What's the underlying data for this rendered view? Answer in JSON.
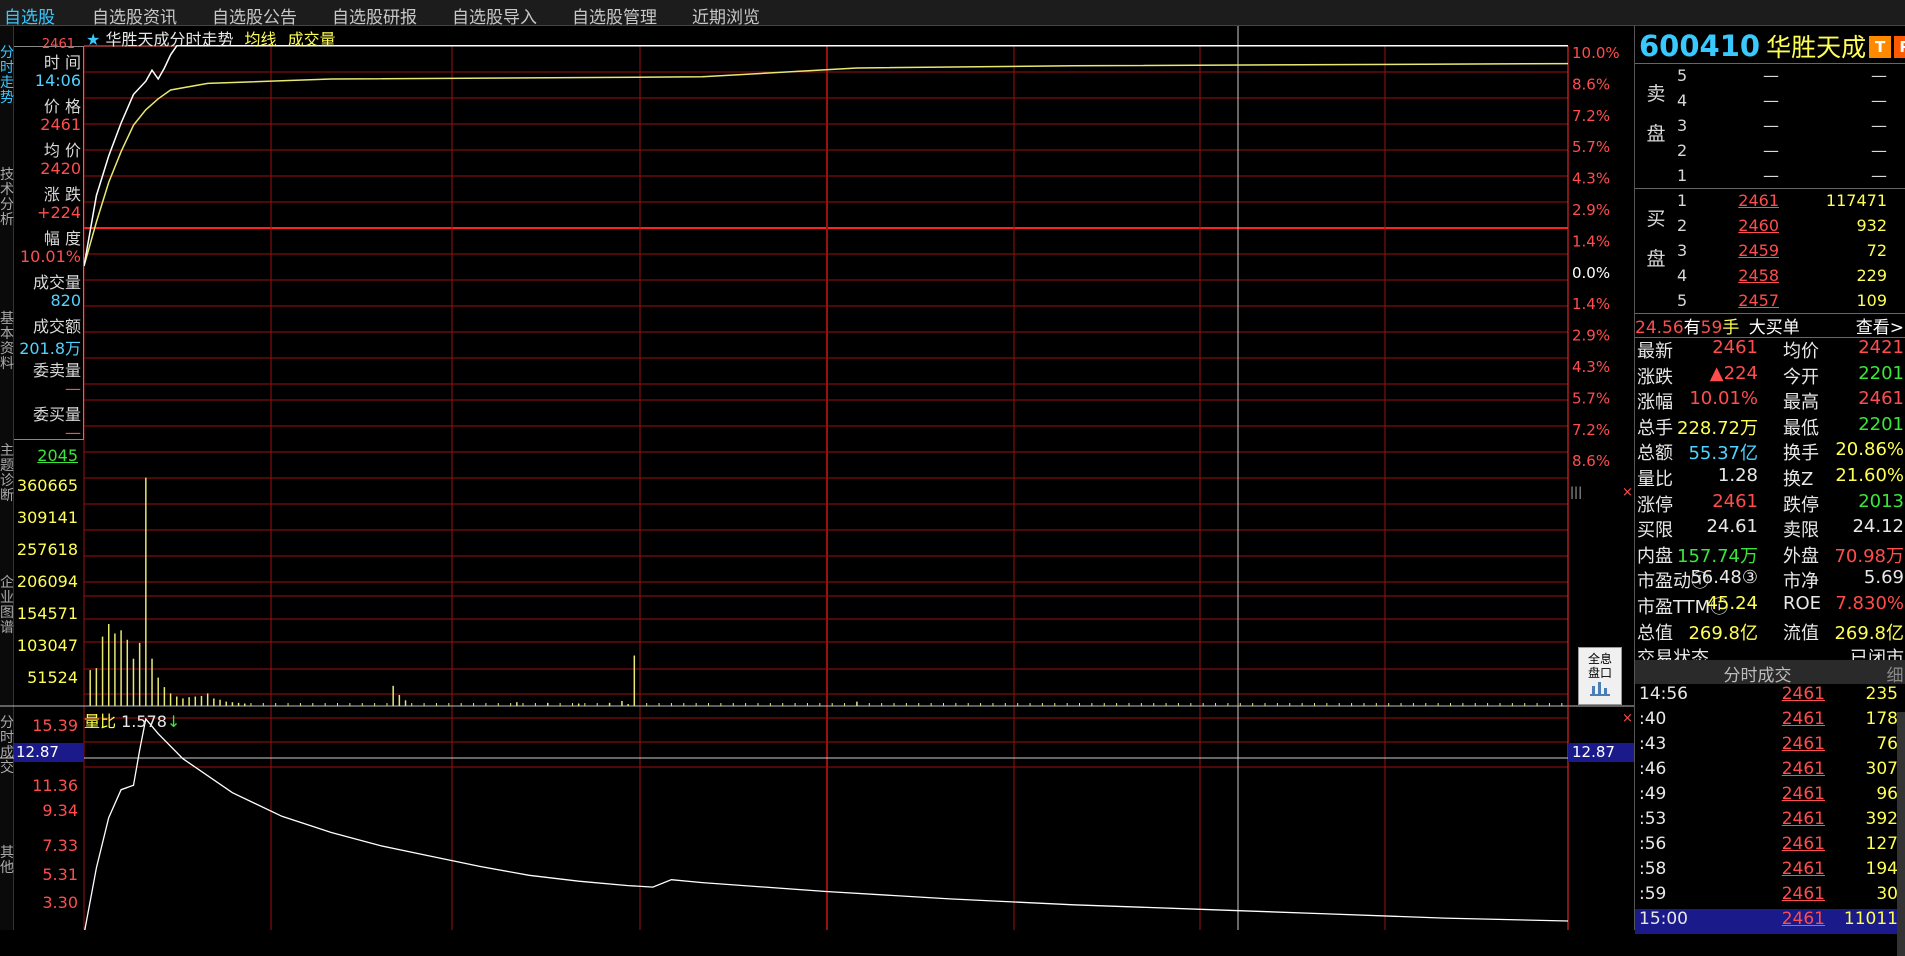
{
  "topbar": {
    "items": [
      "自选股",
      "自选股资讯",
      "自选股公告",
      "自选股研报",
      "自选股导入",
      "自选股管理",
      "近期浏览"
    ]
  },
  "side_tabs": [
    "分时走势",
    "技术分析",
    "基本资料",
    "主题诊断",
    "企业图谱",
    "分时成交",
    "其他"
  ],
  "chart_header": {
    "star": "★",
    "title": "华胜天成分时走势",
    "avg_label": "均线",
    "vol_label": "成交量"
  },
  "info_panel": {
    "time_label": "时 间",
    "time_value": "14:06",
    "price_label": "价 格",
    "price_value": "2461",
    "avg_label": "均 价",
    "avg_value": "2420",
    "chg_label": "涨 跌",
    "chg_value": "+224",
    "pct_label": "幅 度",
    "pct_value": "10.01%",
    "vol_label": "成交量",
    "vol_value": "820",
    "amt_label": "成交额",
    "amt_value": "201.8万",
    "ask_vol_label": "委卖量",
    "ask_vol_value": "—",
    "bid_vol_label": "委买量",
    "bid_vol_value": "—",
    "top_price": "2461",
    "base_price": "2045"
  },
  "pct_axis": [
    "10.0%",
    "8.6%",
    "7.2%",
    "5.7%",
    "4.3%",
    "2.9%",
    "1.4%",
    "0.0%",
    "1.4%",
    "2.9%",
    "4.3%",
    "5.7%",
    "7.2%",
    "8.6%"
  ],
  "vol_axis": [
    "360665",
    "309141",
    "257618",
    "206094",
    "154571",
    "103047",
    "51524"
  ],
  "ratio_panel": {
    "label": "量比",
    "value": "1.578",
    "arrow": "↓",
    "axis": [
      "15.39",
      "11.36",
      "9.34",
      "7.33",
      "5.31",
      "3.30"
    ],
    "current": "12.87"
  },
  "chart_data": {
    "type": "line",
    "price_series": {
      "name": "分时走势",
      "points": [
        [
          0,
          0.0
        ],
        [
          2,
          3.2
        ],
        [
          4,
          5.0
        ],
        [
          6,
          6.5
        ],
        [
          8,
          7.8
        ],
        [
          10,
          8.4
        ],
        [
          11,
          8.9
        ],
        [
          12,
          8.5
        ],
        [
          13,
          9.0
        ],
        [
          14,
          9.6
        ],
        [
          15,
          10.01
        ],
        [
          240,
          10.01
        ]
      ]
    },
    "avg_series": {
      "name": "均线",
      "points": [
        [
          0,
          0.0
        ],
        [
          2,
          2.0
        ],
        [
          4,
          3.8
        ],
        [
          6,
          5.2
        ],
        [
          8,
          6.4
        ],
        [
          10,
          7.1
        ],
        [
          12,
          7.6
        ],
        [
          14,
          8.0
        ],
        [
          20,
          8.3
        ],
        [
          40,
          8.5
        ],
        [
          100,
          8.6
        ],
        [
          125,
          9.0
        ],
        [
          160,
          9.1
        ],
        [
          240,
          9.2
        ]
      ]
    },
    "volume_series": {
      "name": "成交量",
      "points": [
        [
          1,
          57000
        ],
        [
          2,
          60000
        ],
        [
          3,
          110000
        ],
        [
          4,
          130000
        ],
        [
          5,
          115000
        ],
        [
          6,
          120000
        ],
        [
          7,
          105000
        ],
        [
          8,
          75000
        ],
        [
          9,
          100000
        ],
        [
          10,
          362000
        ],
        [
          11,
          75000
        ],
        [
          12,
          45000
        ],
        [
          13,
          30000
        ],
        [
          14,
          20000
        ],
        [
          15,
          15000
        ],
        [
          16,
          12000
        ],
        [
          17,
          14000
        ],
        [
          18,
          15000
        ],
        [
          19,
          16000
        ],
        [
          20,
          20000
        ],
        [
          21,
          12000
        ],
        [
          22,
          10000
        ],
        [
          23,
          7000
        ],
        [
          24,
          6000
        ],
        [
          25,
          5000
        ],
        [
          26,
          4000
        ],
        [
          50,
          32000
        ],
        [
          51,
          17500
        ],
        [
          52,
          9000
        ],
        [
          70,
          6000
        ],
        [
          75,
          5000
        ],
        [
          80,
          4000
        ],
        [
          85,
          5000
        ],
        [
          87,
          8000
        ],
        [
          88,
          3000
        ],
        [
          89,
          80000
        ],
        [
          125,
          7000
        ]
      ]
    },
    "ratio_series": {
      "name": "量比",
      "points": [
        [
          0,
          1.0
        ],
        [
          2,
          5.5
        ],
        [
          4,
          8.9
        ],
        [
          6,
          10.8
        ],
        [
          8,
          11.1
        ],
        [
          9,
          13.5
        ],
        [
          10,
          15.6
        ],
        [
          12,
          14.6
        ],
        [
          16,
          12.9
        ],
        [
          24,
          10.6
        ],
        [
          32,
          9.0
        ],
        [
          40,
          7.9
        ],
        [
          48,
          7.0
        ],
        [
          56,
          6.3
        ],
        [
          64,
          5.6
        ],
        [
          72,
          5.0
        ],
        [
          80,
          4.6
        ],
        [
          88,
          4.3
        ],
        [
          92,
          4.2
        ],
        [
          95,
          4.7
        ],
        [
          100,
          4.5
        ],
        [
          120,
          3.9
        ],
        [
          140,
          3.4
        ],
        [
          160,
          3.0
        ],
        [
          180,
          2.7
        ],
        [
          200,
          2.4
        ],
        [
          220,
          2.1
        ],
        [
          240,
          1.9
        ]
      ]
    },
    "pct_range": [
      -10.0,
      10.0
    ],
    "volume_range": [
      0,
      412189
    ],
    "ratio_range": [
      1.29,
      15.39
    ],
    "minutes": 240
  },
  "quote": {
    "code": "600410",
    "name": "华胜天成",
    "badge_t": "T",
    "badge_r": "R",
    "sell_label": "卖\n\n盘",
    "buy_label": "买\n\n盘",
    "asks": [
      {
        "lvl": "5",
        "px": "—",
        "qty": "—"
      },
      {
        "lvl": "4",
        "px": "—",
        "qty": "—"
      },
      {
        "lvl": "3",
        "px": "—",
        "qty": "—"
      },
      {
        "lvl": "2",
        "px": "—",
        "qty": "—"
      },
      {
        "lvl": "1",
        "px": "—",
        "qty": "—"
      }
    ],
    "bids": [
      {
        "lvl": "1",
        "px": "2461",
        "qty": "117471"
      },
      {
        "lvl": "2",
        "px": "2460",
        "qty": "932"
      },
      {
        "lvl": "3",
        "px": "2459",
        "qty": "72"
      },
      {
        "lvl": "4",
        "px": "2458",
        "qty": "229"
      },
      {
        "lvl": "5",
        "px": "2457",
        "qty": "109"
      }
    ],
    "big_order": {
      "price": "24.56",
      "text1": "有",
      "count": "59",
      "text2": "手",
      "label": "大买单",
      "link": "查看>"
    },
    "stats": [
      {
        "l1": "最新",
        "v1": "2461",
        "c1": "c-red",
        "l2": "均价",
        "v2": "2421",
        "c2": "c-red"
      },
      {
        "l1": "涨跌",
        "v1": "▲224",
        "c1": "c-red",
        "l2": "今开",
        "v2": "2201",
        "c2": "c-green"
      },
      {
        "l1": "涨幅",
        "v1": "10.01%",
        "c1": "c-red",
        "l2": "最高",
        "v2": "2461",
        "c2": "c-red"
      },
      {
        "l1": "总手",
        "v1": "228.72万",
        "c1": "c-yellow",
        "l2": "最低",
        "v2": "2201",
        "c2": "c-green"
      },
      {
        "l1": "总额",
        "v1": "55.37亿",
        "c1": "c-cyan",
        "l2": "换手",
        "v2": "20.86%",
        "c2": "c-yellow"
      },
      {
        "l1": "量比",
        "v1": "1.28",
        "c1": "c-white",
        "l2": "换Z",
        "v2": "21.60%",
        "c2": "c-yellow"
      },
      {
        "l1": "涨停",
        "v1": "2461",
        "c1": "c-red",
        "l2": "跌停",
        "v2": "2013",
        "c2": "c-green"
      },
      {
        "l1": "买限",
        "v1": "24.61",
        "c1": "c-white",
        "l2": "卖限",
        "v2": "24.12",
        "c2": "c-white"
      },
      {
        "l1": "内盘",
        "v1": "157.74万",
        "c1": "c-green",
        "l2": "外盘",
        "v2": "70.98万",
        "c2": "c-red"
      },
      {
        "l1": "市盈动ⓘ",
        "v1": "56.48③",
        "c1": "c-white",
        "l2": "市净",
        "v2": "5.69",
        "c2": "c-white"
      },
      {
        "l1": "市盈TTMⓘ",
        "v1": "45.24",
        "c1": "c-yellow",
        "l2": "ROE",
        "v2": "7.830%",
        "c2": "c-red"
      },
      {
        "l1": "总值",
        "v1": "269.8亿",
        "c1": "c-yellow",
        "l2": "流值",
        "v2": "269.8亿",
        "c2": "c-yellow"
      },
      {
        "l1": "交易状态",
        "v1": "",
        "c1": "c-white",
        "l2": "",
        "v2": "已闭市",
        "c2": "c-white"
      }
    ],
    "ticks_title": "分时成交",
    "ticks_detail": "细",
    "ticks": [
      {
        "t": "14:56",
        "p": "2461",
        "v": "235"
      },
      {
        "t": ":40",
        "p": "2461",
        "v": "178"
      },
      {
        "t": ":43",
        "p": "2461",
        "v": "76"
      },
      {
        "t": ":46",
        "p": "2461",
        "v": "307"
      },
      {
        "t": ":49",
        "p": "2461",
        "v": "96"
      },
      {
        "t": ":53",
        "p": "2461",
        "v": "392"
      },
      {
        "t": ":56",
        "p": "2461",
        "v": "127"
      },
      {
        "t": ":58",
        "p": "2461",
        "v": "194"
      },
      {
        "t": ":59",
        "p": "2461",
        "v": "30"
      },
      {
        "t": "15:00",
        "p": "2461",
        "v": "11011"
      }
    ]
  },
  "panel_button": "全息\n盘口",
  "colors": {
    "up": "#ff4d4d",
    "down": "#39e639",
    "grid": "#9a1010",
    "price_line": "#ffffff",
    "avg_line": "#e8e870",
    "volume": "#e8e870"
  }
}
